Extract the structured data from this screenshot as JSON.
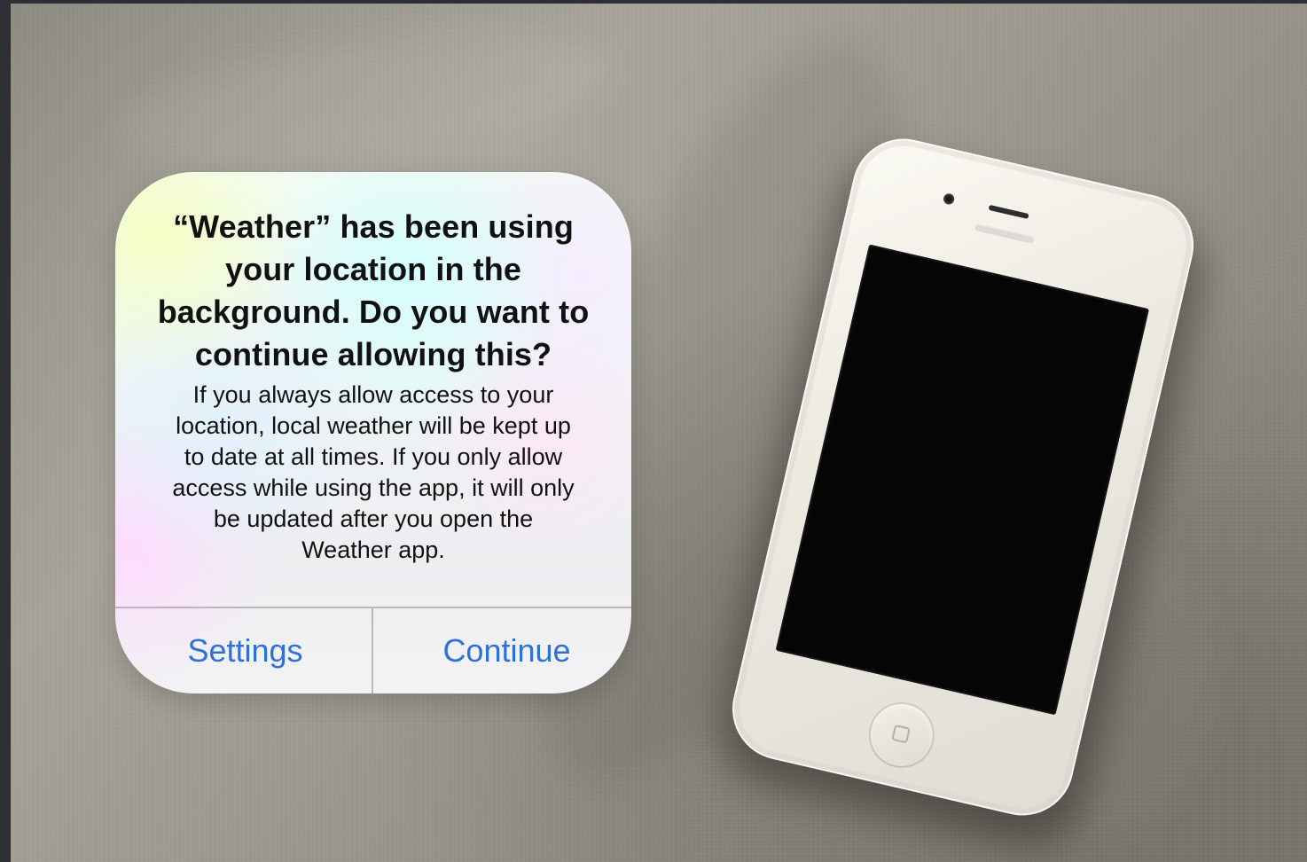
{
  "alert": {
    "title": "“Weather” has been using\nyour location in the\nbackground. Do you want to\ncontinue allowing this?",
    "message": "If you always allow access to your\nlocation, local weather will be kept up\nto date at all times. If you only allow\naccess while using the app, it will only\nbe updated after you open the\nWeather app.",
    "buttons": {
      "settings": "Settings",
      "continue": "Continue"
    }
  },
  "theme": {
    "accent": "#2e72d8",
    "phone_color": "#f5f3ec",
    "screen_color": "#050505"
  },
  "icons": {
    "phone_camera": "camera-icon",
    "phone_speaker": "speaker-icon",
    "phone_home": "home-button-icon"
  }
}
